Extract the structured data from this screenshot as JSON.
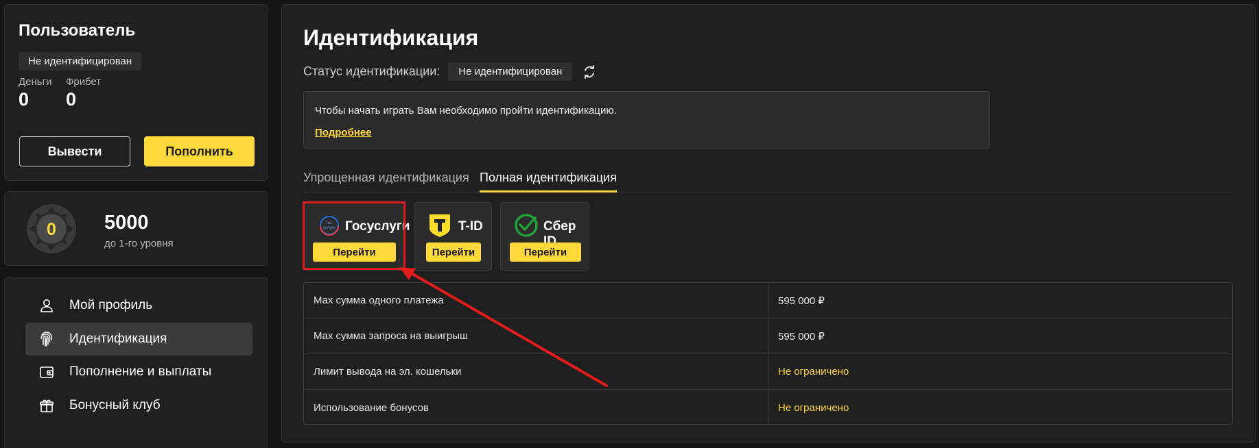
{
  "user": {
    "title": "Пользователь",
    "status_badge": "Не идентифицирован",
    "money_label": "Деньги",
    "money_value": "0",
    "freebet_label": "Фрибет",
    "freebet_value": "0",
    "withdraw_label": "Вывести",
    "deposit_label": "Пополнить"
  },
  "level": {
    "badge_number": "0",
    "points": "5000",
    "subtitle": "до 1-го уровня"
  },
  "menu": {
    "items": [
      {
        "label": "Мой профиль",
        "icon": "user-icon",
        "active": false
      },
      {
        "label": "Идентификация",
        "icon": "fingerprint-icon",
        "active": true
      },
      {
        "label": "Пополнение и выплаты",
        "icon": "wallet-icon",
        "active": false
      },
      {
        "label": "Бонусный клуб",
        "icon": "gift-icon",
        "active": false
      }
    ]
  },
  "main": {
    "title": "Идентификация",
    "status_label": "Статус идентификации:",
    "status_value": "Не идентифицирован",
    "notice_text": "Чтобы начать играть Вам необходимо пройти идентификацию.",
    "notice_link": "Подробнее",
    "tabs": [
      {
        "label": "Упрощенная идентификация",
        "active": false
      },
      {
        "label": "Полная идентификация",
        "active": true
      }
    ],
    "providers": [
      {
        "name": "Госуслуги",
        "button": "Перейти",
        "logo_text": "гос\nуслуги"
      },
      {
        "name": "T-ID",
        "button": "Перейти",
        "logo_text": "T"
      },
      {
        "name": "Сбер ID",
        "button": "Перейти"
      }
    ],
    "limits": [
      {
        "label": "Max сумма одного платежа",
        "value": "595 000 ₽",
        "accent": false
      },
      {
        "label": "Max сумма запроса на выигрыш",
        "value": "595 000 ₽",
        "accent": false
      },
      {
        "label": "Лимит вывода на эл. кошельки",
        "value": "Не ограничено",
        "accent": true
      },
      {
        "label": "Использование бонусов",
        "value": "Не ограничено",
        "accent": true
      }
    ]
  },
  "colors": {
    "accent": "#ffd83a",
    "highlight": "#e21b1b",
    "panel": "#1f1f1f",
    "background": "#141414"
  }
}
